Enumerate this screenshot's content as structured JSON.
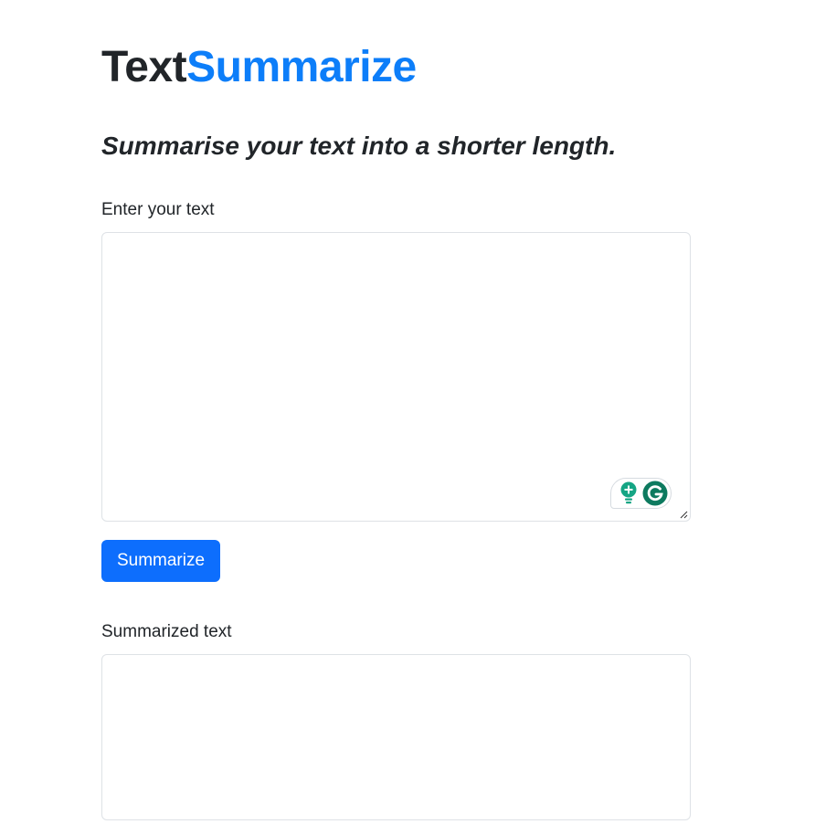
{
  "header": {
    "brand_part1": "Text",
    "brand_part2": "Summarize",
    "tagline": "Summarise your text into a shorter length."
  },
  "input_section": {
    "label": "Enter your text",
    "value": "",
    "placeholder": ""
  },
  "actions": {
    "summarize_label": "Summarize"
  },
  "output_section": {
    "label": "Summarized text",
    "value": ""
  },
  "grammarly": {
    "icons": [
      "lightbulb-icon",
      "grammarly-g-icon"
    ],
    "colors": {
      "green": "#15a584",
      "dark_green": "#0d7a5f"
    }
  },
  "colors": {
    "brand_dark": "#212529",
    "brand_accent": "#0d7ef9",
    "button_bg": "#0d6efd",
    "button_text": "#ffffff",
    "border": "#dee2e6"
  }
}
